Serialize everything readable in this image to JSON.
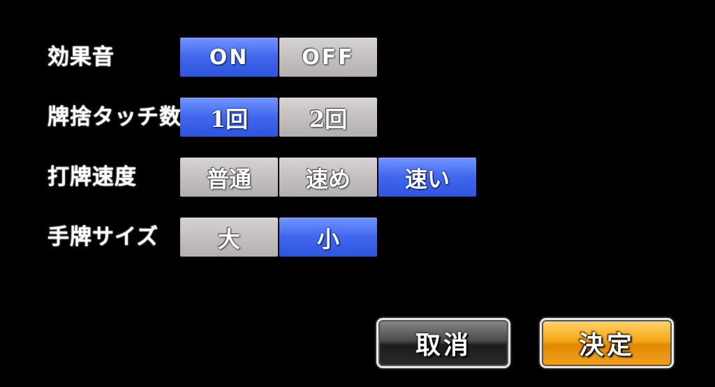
{
  "settings": {
    "sound_effects": {
      "label": "効果音",
      "options": [
        "ON",
        "OFF"
      ],
      "selected": "ON"
    },
    "discard_touch": {
      "label": "牌捨タッチ数",
      "options": [
        "1回",
        "2回"
      ],
      "selected": "1回"
    },
    "discard_speed": {
      "label": "打牌速度",
      "options": [
        "普通",
        "速め",
        "速い"
      ],
      "selected": "速い"
    },
    "tile_size": {
      "label": "手牌サイズ",
      "options": [
        "大",
        "小"
      ],
      "selected": "小"
    }
  },
  "buttons": {
    "cancel_label": "取消",
    "confirm_label": "決定"
  },
  "colors": {
    "selected": "#3f66ec",
    "unselected": "#c3bebe",
    "confirm": "#f6a61a",
    "cancel": "#2a2a2a"
  }
}
